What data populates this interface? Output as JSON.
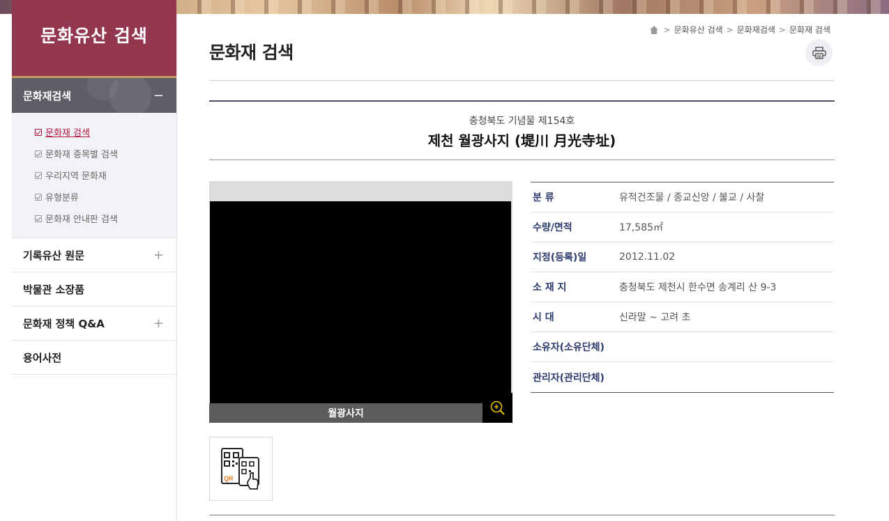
{
  "sidebar": {
    "title": "문화유산 검색",
    "open_menu": {
      "label": "문화재검색",
      "toggle": "−"
    },
    "sub_items": [
      {
        "label": "문화재 검색",
        "active": true
      },
      {
        "label": "문화재 종목별 검색",
        "active": false
      },
      {
        "label": "우리지역 문화재",
        "active": false
      },
      {
        "label": "유형분류",
        "active": false
      },
      {
        "label": "문화재 안내판 검색",
        "active": false
      }
    ],
    "items": [
      {
        "label": "기록유산 원문",
        "toggle": "+"
      },
      {
        "label": "박물관 소장품",
        "toggle": ""
      },
      {
        "label": "문화재 정책 Q&A",
        "toggle": "+"
      },
      {
        "label": "용어사전",
        "toggle": ""
      }
    ]
  },
  "header": {
    "page_title": "문화재 검색",
    "breadcrumb": [
      "문화유산 검색",
      "문화재검색",
      "문화재 검색"
    ]
  },
  "heritage": {
    "designation": "충청북도 기념물 제154호",
    "name": "제천 월광사지 (堤川 月光寺址)",
    "image_caption": "월광사지",
    "info": [
      {
        "label": "분 류",
        "value": "유적건조물 / 종교신앙 / 불교 / 사찰"
      },
      {
        "label": "수량/면적",
        "value": "17,585㎡"
      },
      {
        "label": "지정(등록)일",
        "value": "2012.11.02"
      },
      {
        "label": "소 재 지",
        "value": "충청북도 제천시 한수면 송계리 산 9-3"
      },
      {
        "label": "시 대",
        "value": "신라말 ~ 고려 초"
      },
      {
        "label": "소유자(소유단체)",
        "value": ""
      },
      {
        "label": "관리자(관리단체)",
        "value": ""
      }
    ],
    "qr_label": "QR"
  },
  "colors": {
    "sidebar_title_bg": "#93374f",
    "active_sub": "#b5163d",
    "label_color": "#2c3a6b",
    "zoom_accent": "#e8c200"
  }
}
